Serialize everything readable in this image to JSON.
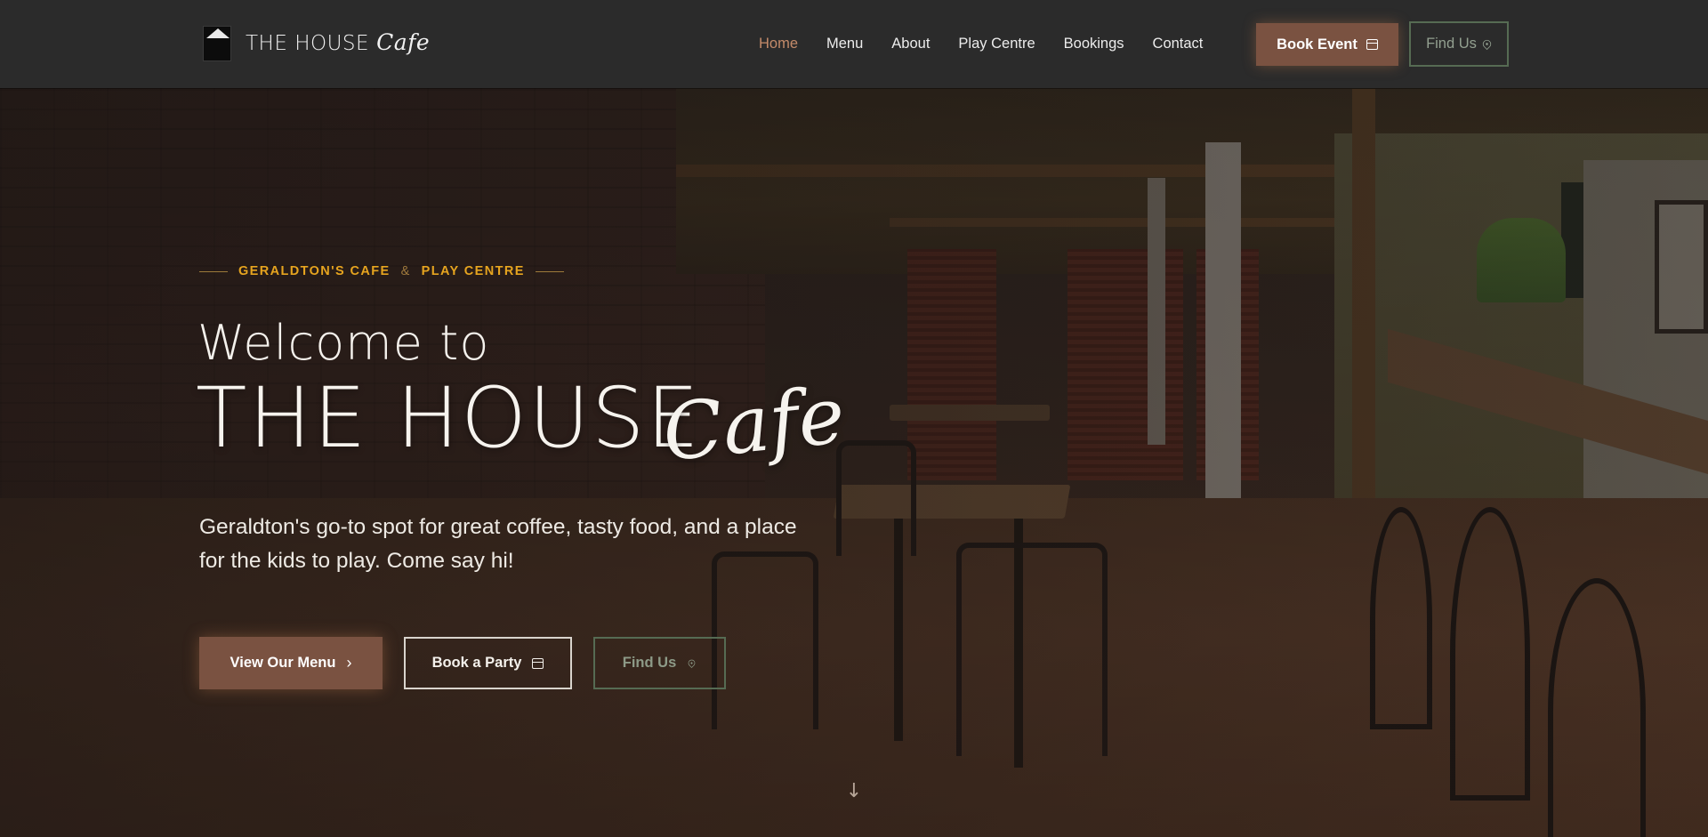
{
  "header": {
    "logo_text": "the HOUSE cafe",
    "brand_main": "THE HOUSE",
    "brand_script": "Cafe",
    "nav": [
      {
        "label": "Home",
        "active": true
      },
      {
        "label": "Menu"
      },
      {
        "label": "About"
      },
      {
        "label": "Play Centre"
      },
      {
        "label": "Bookings"
      },
      {
        "label": "Contact"
      }
    ],
    "book_event_label": "Book Event",
    "find_us_label": "Find Us",
    "icons": {
      "calendar": "calendar-icon",
      "location": "location-pin-icon"
    }
  },
  "hero": {
    "eyebrow_part1": "GERALDTON'S CAFE",
    "eyebrow_amp": "&",
    "eyebrow_part2": "PLAY CENTRE",
    "welcome": "Welcome to",
    "title_main": "THE HOUSE",
    "title_script": "Cafe",
    "lead": "Geraldton's go-to spot for great coffee, tasty food, and a place for the kids to play. Come say hi!",
    "buttons": {
      "menu": "View Our Menu",
      "party": "Book a Party",
      "find": "Find Us"
    },
    "scroll_icon": "arrow-down-icon"
  },
  "colors": {
    "accent_brown": "#7a5241",
    "active_nav": "#c48b6a",
    "eyebrow_gold": "#e6a41f",
    "outline_green": "#566b53",
    "nav_bg": "#2b2b2b"
  }
}
